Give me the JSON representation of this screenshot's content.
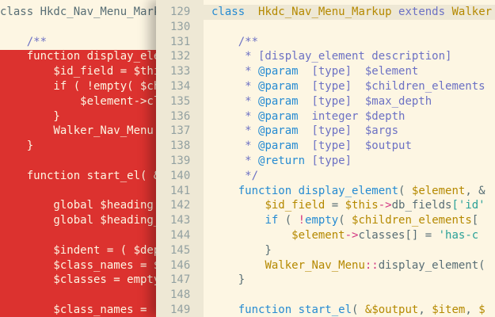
{
  "left_editor": {
    "lines": [
      {
        "t": "class Hkdc_Nav_Menu_Markup",
        "style": "tx"
      },
      {
        "t": "",
        "style": "tx"
      },
      {
        "t": "    /**",
        "style": "cm"
      },
      {
        "t": "    function display_ele",
        "style": "w"
      },
      {
        "t": "        $id_field = $thi",
        "style": "w"
      },
      {
        "t": "        if ( !empty( $ch",
        "style": "w"
      },
      {
        "t": "            $element->cl",
        "style": "w"
      },
      {
        "t": "        }",
        "style": "w"
      },
      {
        "t": "        Walker_Nav_Menu:",
        "style": "w"
      },
      {
        "t": "    }",
        "style": "w"
      },
      {
        "t": "",
        "style": "w"
      },
      {
        "t": "    function start_el( &",
        "style": "w"
      },
      {
        "t": "",
        "style": "w"
      },
      {
        "t": "        global $heading",
        "style": "w"
      },
      {
        "t": "        global $heading_",
        "style": "w"
      },
      {
        "t": "",
        "style": "w"
      },
      {
        "t": "        $indent = ( $dep",
        "style": "w"
      },
      {
        "t": "        $class_names = $",
        "style": "w"
      },
      {
        "t": "        $classes = empty",
        "style": "w"
      },
      {
        "t": "",
        "style": "w"
      },
      {
        "t": "        $class_names = ",
        "style": "w"
      }
    ]
  },
  "right_editor": {
    "lines": [
      {
        "n": "129",
        "segs": [
          [
            "class",
            "kw"
          ],
          [
            "  ",
            "tx"
          ],
          [
            "Hkdc_Nav_Menu_Markup",
            "cls"
          ],
          [
            " ",
            "tx"
          ],
          [
            "extends",
            "ext"
          ],
          [
            " ",
            "tx"
          ],
          [
            "Walker",
            "cls"
          ]
        ]
      },
      {
        "n": "130",
        "segs": []
      },
      {
        "n": "131",
        "segs": [
          [
            "    /**",
            "cm"
          ]
        ]
      },
      {
        "n": "132",
        "segs": [
          [
            "     * [display_element description]",
            "cm"
          ]
        ]
      },
      {
        "n": "133",
        "segs": [
          [
            "     * ",
            "cm"
          ],
          [
            "@param",
            "tg"
          ],
          [
            "  [type]  $element",
            "cm"
          ]
        ]
      },
      {
        "n": "134",
        "segs": [
          [
            "     * ",
            "cm"
          ],
          [
            "@param",
            "tg"
          ],
          [
            "  [type]  $children_elements",
            "cm"
          ]
        ]
      },
      {
        "n": "135",
        "segs": [
          [
            "     * ",
            "cm"
          ],
          [
            "@param",
            "tg"
          ],
          [
            "  [type]  $max_depth",
            "cm"
          ]
        ]
      },
      {
        "n": "136",
        "segs": [
          [
            "     * ",
            "cm"
          ],
          [
            "@param",
            "tg"
          ],
          [
            "  integer $depth",
            "cm"
          ]
        ]
      },
      {
        "n": "137",
        "segs": [
          [
            "     * ",
            "cm"
          ],
          [
            "@param",
            "tg"
          ],
          [
            "  [type]  $args",
            "cm"
          ]
        ]
      },
      {
        "n": "138",
        "segs": [
          [
            "     * ",
            "cm"
          ],
          [
            "@param",
            "tg"
          ],
          [
            "  [type]  $output",
            "cm"
          ]
        ]
      },
      {
        "n": "139",
        "segs": [
          [
            "     * ",
            "cm"
          ],
          [
            "@return",
            "tg"
          ],
          [
            " [type]",
            "cm"
          ]
        ]
      },
      {
        "n": "140",
        "segs": [
          [
            "     */",
            "cm"
          ]
        ]
      },
      {
        "n": "141",
        "segs": [
          [
            "    ",
            "tx"
          ],
          [
            "function",
            "kw"
          ],
          [
            " ",
            "tx"
          ],
          [
            "display_element",
            "fn"
          ],
          [
            "( ",
            "tx"
          ],
          [
            "$element",
            "var"
          ],
          [
            ", &",
            "tx"
          ]
        ]
      },
      {
        "n": "142",
        "segs": [
          [
            "        ",
            "tx"
          ],
          [
            "$id_field",
            "var"
          ],
          [
            " = ",
            "tx"
          ],
          [
            "$this",
            "var"
          ],
          [
            "->",
            "op"
          ],
          [
            "db_fields",
            "tx"
          ],
          [
            "['id'",
            "str"
          ]
        ]
      },
      {
        "n": "143",
        "segs": [
          [
            "        ",
            "tx"
          ],
          [
            "if",
            "kw"
          ],
          [
            " ( ",
            "tx"
          ],
          [
            "!",
            "op"
          ],
          [
            "empty",
            "kw"
          ],
          [
            "( ",
            "tx"
          ],
          [
            "$children_elements",
            "var"
          ],
          [
            "[",
            "tx"
          ]
        ]
      },
      {
        "n": "144",
        "segs": [
          [
            "            ",
            "tx"
          ],
          [
            "$element",
            "var"
          ],
          [
            "->",
            "op"
          ],
          [
            "classes[] = ",
            "tx"
          ],
          [
            "'has-c",
            "str"
          ]
        ]
      },
      {
        "n": "145",
        "segs": [
          [
            "        }",
            "tx"
          ]
        ]
      },
      {
        "n": "146",
        "segs": [
          [
            "        ",
            "tx"
          ],
          [
            "Walker_Nav_Menu",
            "cls"
          ],
          [
            "::",
            "op"
          ],
          [
            "display_element(",
            "tx"
          ]
        ]
      },
      {
        "n": "147",
        "segs": [
          [
            "    }",
            "tx"
          ]
        ]
      },
      {
        "n": "148",
        "segs": []
      },
      {
        "n": "149",
        "segs": [
          [
            "    ",
            "tx"
          ],
          [
            "function",
            "kw"
          ],
          [
            " ",
            "tx"
          ],
          [
            "start_el",
            "fn"
          ],
          [
            "( ",
            "tx"
          ],
          [
            "&$output",
            "var"
          ],
          [
            ", ",
            "tx"
          ],
          [
            "$item",
            "var"
          ],
          [
            ", ",
            "tx"
          ],
          [
            "$",
            "var"
          ]
        ]
      }
    ]
  }
}
